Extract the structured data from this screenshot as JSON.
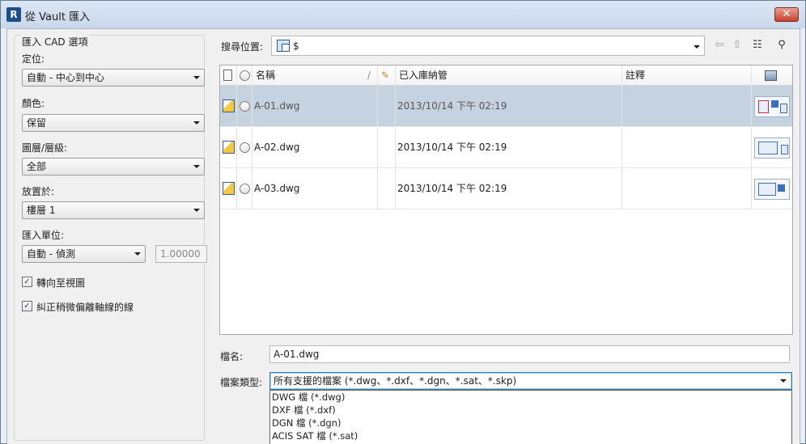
{
  "window": {
    "title": "從 Vault 匯入",
    "app_icon_letter": "R",
    "close_glyph": "✕"
  },
  "options": {
    "group_title": "匯入 CAD 選項",
    "positioning": {
      "label": "定位:",
      "value": "自動 - 中心到中心"
    },
    "colors": {
      "label": "顏色:",
      "value": "保留"
    },
    "layers": {
      "label": "圖層/層級:",
      "value": "全部"
    },
    "place_at": {
      "label": "放置於:",
      "value": "樓層 1"
    },
    "import_units": {
      "label": "匯入單位:",
      "value": "自動 - 偵測",
      "scale": "1.00000"
    },
    "orient_to_view": {
      "label": "轉向至視圖",
      "checked": true
    },
    "correct_lines": {
      "label": "糾正稍微偏離軸線的線",
      "checked": true
    }
  },
  "lookin": {
    "label": "搜尋位置:",
    "value": "$",
    "icon": "vault-folder-icon"
  },
  "toolbar": {
    "back_icon": "⇦",
    "up_icon": "⇧",
    "views_icon": "☷",
    "find_icon": "⚲"
  },
  "columns": {
    "name": "名稱",
    "checked_in": "已入庫納管",
    "comments": "註釋",
    "sort_glyph": "/",
    "edit_glyph": "✎"
  },
  "files": [
    {
      "name": "A-01.dwg",
      "date": "2013/10/14 下午 02:19",
      "selected": true
    },
    {
      "name": "A-02.dwg",
      "date": "2013/10/14 下午 02:19",
      "selected": false
    },
    {
      "name": "A-03.dwg",
      "date": "2013/10/14 下午 02:19",
      "selected": false
    }
  ],
  "filename": {
    "label": "檔名:",
    "value": "A-01.dwg"
  },
  "filetype": {
    "label": "檔案類型:",
    "value": "所有支援的檔案 (*.dwg、*.dxf、*.dgn、*.sat、*.skp)",
    "options": [
      "DWG 檔 (*.dwg)",
      "DXF 檔 (*.dxf)",
      "DGN 檔 (*.dgn)",
      "ACIS SAT 檔 (*.sat)"
    ]
  },
  "colors": {
    "selected_row": "#c5d2e0",
    "close_button": "#c8402c",
    "focus_border": "#3c7fb1"
  }
}
